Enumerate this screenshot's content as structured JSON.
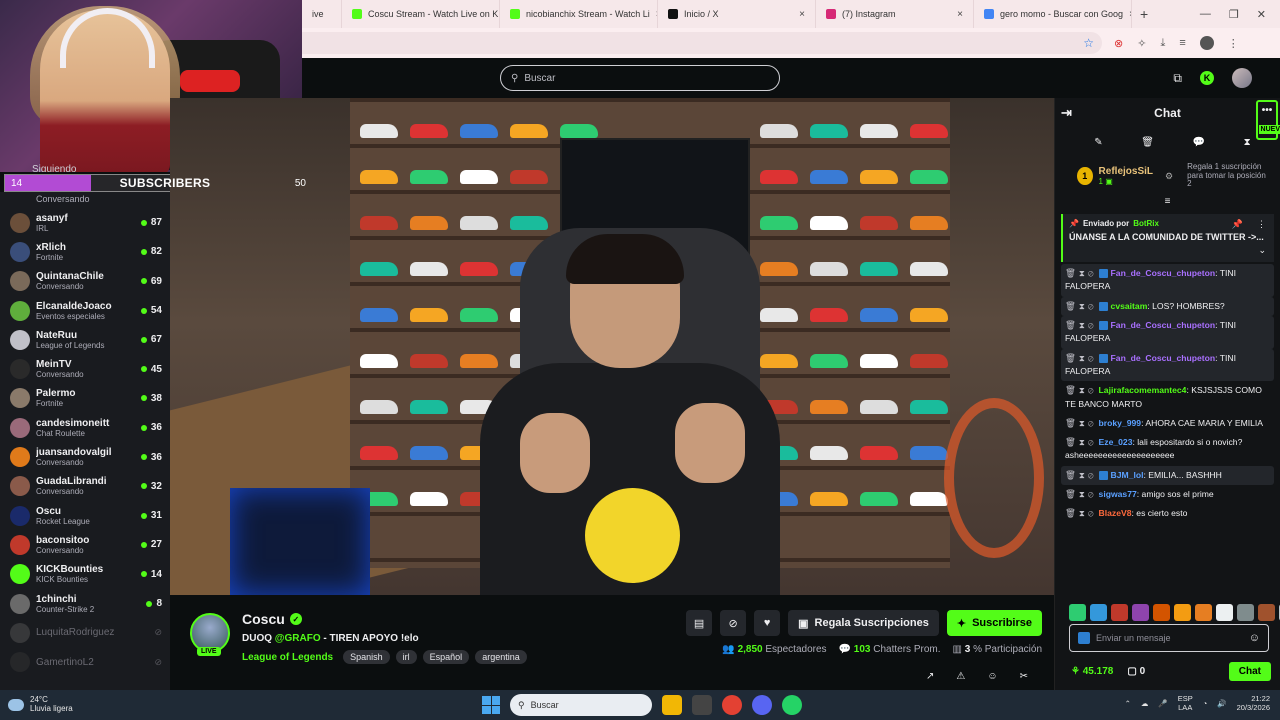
{
  "browser": {
    "tabs": [
      {
        "label": "ive",
        "color": "#53fc18"
      },
      {
        "label": "Coscu Stream - Watch Live on K",
        "color": "#53fc18"
      },
      {
        "label": "nicobianchix Stream - Watch Li",
        "color": "#53fc18"
      },
      {
        "label": "Inicio / X",
        "color": "#111111"
      },
      {
        "label": "(7) Instagram",
        "color": "#d62976"
      },
      {
        "label": "gero momo - Buscar con Goog",
        "color": "#4285f4"
      }
    ],
    "tab_close": "×",
    "new_tab": "+",
    "win_controls": [
      "—",
      "❐",
      "✕"
    ],
    "addr_icons": [
      "☆",
      "⊗",
      "✧",
      "⤓",
      "≡",
      "●",
      "⋮"
    ]
  },
  "webcam": {
    "partial_label": "Siguiendo"
  },
  "sub_goal": {
    "current": "14",
    "title": "SUBSCRIBERS",
    "target": "50",
    "progress": 0.28
  },
  "sidebar": {
    "top_category": "Conversando",
    "channels": [
      {
        "name": "asanyf",
        "category": "IRL",
        "viewers": "87",
        "color": "#6b4f3a",
        "online": true
      },
      {
        "name": "xRlich",
        "category": "Fortnite",
        "viewers": "82",
        "color": "#3a4e7a",
        "online": true
      },
      {
        "name": "QuintanaChile",
        "category": "Conversando",
        "viewers": "69",
        "color": "#7a6a5a",
        "online": true
      },
      {
        "name": "ElcanaldeJoaco",
        "category": "Eventos especiales",
        "viewers": "54",
        "color": "#5fae3c",
        "online": true
      },
      {
        "name": "NateRuu",
        "category": "League of Legends",
        "viewers": "67",
        "color": "#c0c0c8",
        "online": true
      },
      {
        "name": "MeinTV",
        "category": "Conversando",
        "viewers": "45",
        "color": "#2a2a2a",
        "online": true
      },
      {
        "name": "Palermo",
        "category": "Fortnite",
        "viewers": "38",
        "color": "#8a7a6a",
        "online": true
      },
      {
        "name": "candesimoneitt",
        "category": "Chat Roulette",
        "viewers": "36",
        "color": "#9a6a7a",
        "online": true
      },
      {
        "name": "juansandovalgil",
        "category": "Conversando",
        "viewers": "36",
        "color": "#e07a1a",
        "online": true
      },
      {
        "name": "GuadaLibrandi",
        "category": "Conversando",
        "viewers": "32",
        "color": "#8a5a4a",
        "online": true
      },
      {
        "name": "Oscu",
        "category": "Rocket League",
        "viewers": "31",
        "color": "#1a2a6a",
        "online": true
      },
      {
        "name": "baconsitoo",
        "category": "Conversando",
        "viewers": "27",
        "color": "#c0392b",
        "online": true
      },
      {
        "name": "KICKBounties",
        "category": "KICK Bounties",
        "viewers": "14",
        "color": "#53fc18",
        "online": true
      },
      {
        "name": "1chinchi",
        "category": "Counter-Strike 2",
        "viewers": "8",
        "color": "#6a6a6a",
        "online": true
      },
      {
        "name": "LuquitaRodriguez",
        "category": "",
        "viewers": "",
        "color": "#555555",
        "online": false
      },
      {
        "name": "GamertinoL2",
        "category": "",
        "viewers": "",
        "color": "#333333",
        "online": false
      }
    ],
    "offline_icon": "⊘"
  },
  "kick_header": {
    "search_placeholder": "Buscar",
    "search_icon": "⚲",
    "icons": [
      "⧉",
      "K"
    ]
  },
  "stream": {
    "channel_name": "Coscu",
    "live_label": "LIVE",
    "title_prefix": "DUOQ ",
    "title_mention": "@GRAFO",
    "title_suffix": " - TIREN APOYO !elo",
    "category": "League of Legends",
    "tags": [
      "Spanish",
      "irl",
      "Español",
      "argentina"
    ],
    "gift_label": "Regala Suscripciones",
    "subscribe_label": "Suscribirse",
    "viewers": "2,850",
    "viewers_label": "Espectadores",
    "chatters": "103",
    "chatters_label": "Chatters Prom.",
    "participation": "3",
    "participation_label": "% Participación",
    "under_icons": [
      "↗",
      "⚠",
      "☺",
      "✂"
    ]
  },
  "chat": {
    "title": "Chat",
    "new_label": "NUEV",
    "more": "•••",
    "mod_tools": [
      "✎",
      "🗑",
      "💬",
      "⧗"
    ],
    "top_gifter": {
      "rank": "1",
      "name": "ReflejosSiL",
      "count": "1",
      "hint": "Regala 1 suscripción para tomar la posición 2"
    },
    "pinned": {
      "sent_by": "Enviado por",
      "bot_name": "BotRix",
      "text": "ÚNANSE A LA COMUNIDAD DE TWITTER ->..."
    },
    "messages": [
      {
        "user": "Fan_de_Coscu_chupeton",
        "color": "#a970ff",
        "text": ": TINI FALOPERA",
        "highlight": true
      },
      {
        "user": "cvsaitam",
        "color": "#53fc18",
        "text": ": LOS? HOMBRES?",
        "highlight": true
      },
      {
        "user": "Fan_de_Coscu_chupeton",
        "color": "#a970ff",
        "text": ": TINI FALOPERA",
        "highlight": true
      },
      {
        "user": "Fan_de_Coscu_chupeton",
        "color": "#a970ff",
        "text": ": TINI FALOPERA",
        "highlight": true
      },
      {
        "user": "Lajirafacomemantec4",
        "color": "#53fc18",
        "text": ": KSJSJSJS COMO TE BANCO MARTO",
        "highlight": false
      },
      {
        "user": "broky_999",
        "color": "#5aa0ff",
        "text": ": AHORA CAE MARIA Y EMILIA",
        "highlight": false
      },
      {
        "user": "Eze_023",
        "color": "#5aa0ff",
        "text": ": lali espositardo si o novich? asheeeeeeeeeeeeeeeeeeee",
        "highlight": false
      },
      {
        "user": "BJM_lol",
        "color": "#5aa0ff",
        "text": ": EMILIA... BASHHH",
        "highlight": true
      },
      {
        "user": "sigwas77",
        "color": "#5aa0ff",
        "text": ": amigo sos el prime",
        "highlight": false
      },
      {
        "user": "BlazeV8",
        "color": "#ff6a3d",
        "text": ": es cierto esto",
        "highlight": false
      }
    ],
    "input_placeholder": "Enviar un mensaje",
    "points": "45.178",
    "zero": "0",
    "send_label": "Chat"
  },
  "taskbar": {
    "temp": "24°C",
    "weather": "Lluvia ligera",
    "search": "Buscar",
    "lang1": "ESP",
    "lang2": "LAA",
    "time": "21:22",
    "date": "20/3/2026"
  }
}
